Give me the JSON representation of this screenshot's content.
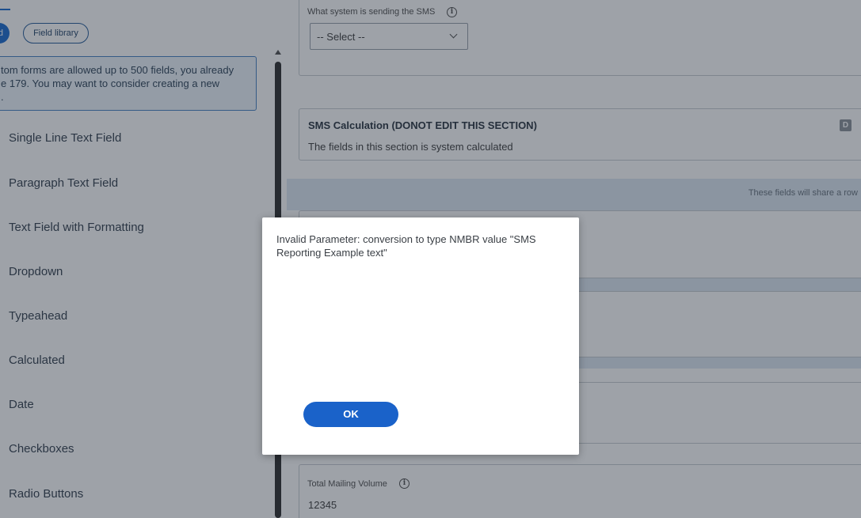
{
  "left": {
    "pill_active_label": "d",
    "pill_library_label": "Field library",
    "info_lines": [
      "tom forms are allowed up to 500 fields, you already",
      "e 179. You may want to consider creating a new",
      "."
    ],
    "fields": [
      {
        "label": "Single Line Text Field"
      },
      {
        "label": "Paragraph Text Field"
      },
      {
        "label": "Text Field with Formatting"
      },
      {
        "label": "Dropdown"
      },
      {
        "label": "Typeahead"
      },
      {
        "label": "Calculated"
      },
      {
        "label": "Date"
      },
      {
        "label": "Checkboxes"
      },
      {
        "label": "Radio Buttons"
      }
    ]
  },
  "right": {
    "sms_system_label": "What system is sending the SMS",
    "sms_select_value": "-- Select --",
    "section_title": "SMS Calculation (DONOT EDIT THIS SECTION)",
    "section_desc": "The fields in this section is system calculated",
    "section_badge": "D",
    "share_row_text": "These fields will share a row",
    "mailing_label": "Total Mailing Volume",
    "mailing_value": "12345"
  },
  "dialog": {
    "message": "Invalid Parameter: conversion to type NMBR value \"SMS Reporting Example text\"",
    "ok_label": "OK"
  },
  "icons": {
    "info": "info-icon",
    "chevron": "chevron-down-icon",
    "scroll_up": "scroll-up-arrow-icon"
  },
  "colors": {
    "accent": "#1a62c9",
    "overlay": "#182230"
  }
}
